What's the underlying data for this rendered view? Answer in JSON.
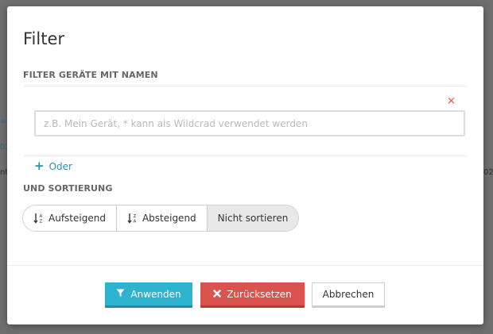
{
  "background": {
    "fragments": [
      "≡",
      "02",
      "nt",
      "02"
    ]
  },
  "dialog": {
    "title": "Filter",
    "name_section_label": "FILTER GERÄTE MIT NAMEN",
    "clear_symbol": "×",
    "name_input": {
      "value": "",
      "placeholder": "z.B. Mein Gerät, * kann als Wildcrad verwendet werden"
    },
    "or_link": {
      "icon": "plus-icon",
      "label": "Oder"
    },
    "sort_section_label": "UND SORTIERUNG",
    "sort_options": [
      {
        "label": "Aufsteigend",
        "icon": "sort-ascending-icon",
        "active": false
      },
      {
        "label": "Absteigend",
        "icon": "sort-descending-icon",
        "active": false
      },
      {
        "label": "Nicht sortieren",
        "icon": "",
        "active": true
      }
    ],
    "buttons": {
      "apply": {
        "label": "Anwenden",
        "icon": "filter-icon",
        "color": "#2eb3cf"
      },
      "reset": {
        "label": "Zurücksetzen",
        "icon": "close-icon",
        "color": "#d9534f"
      },
      "cancel": {
        "label": "Abbrechen"
      }
    }
  }
}
